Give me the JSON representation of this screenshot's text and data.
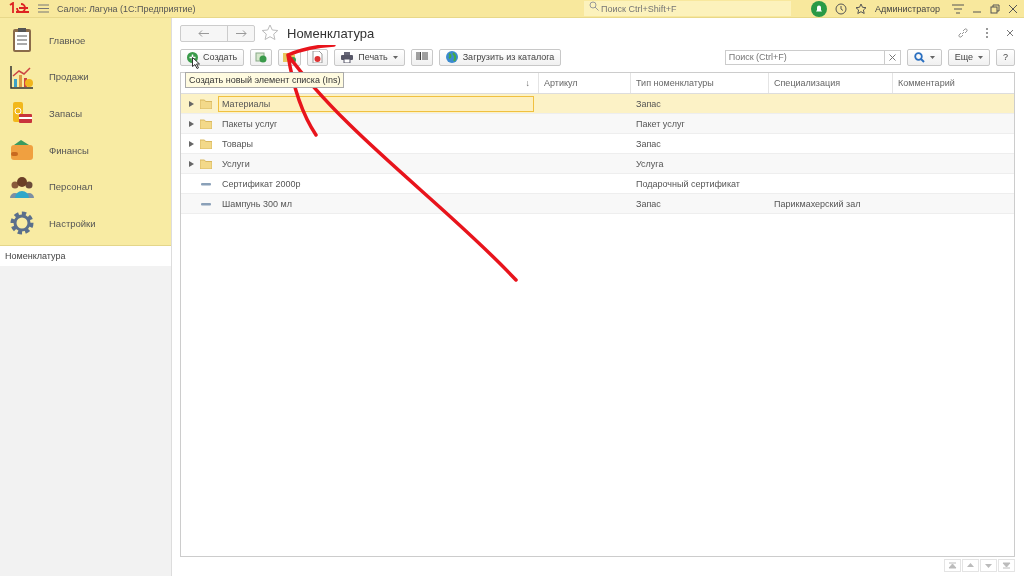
{
  "topbar": {
    "app_title": "Салон: Лагуна  (1С:Предприятие)",
    "search_placeholder": "Поиск Ctrl+Shift+F",
    "user": "Администратор"
  },
  "sidebar": {
    "sections": [
      {
        "label": "Главное",
        "selected": false
      },
      {
        "label": "Продажи",
        "selected": false
      },
      {
        "label": "Запасы",
        "selected": false
      },
      {
        "label": "Финансы",
        "selected": false
      },
      {
        "label": "Персонал",
        "selected": false
      },
      {
        "label": "Настройки",
        "selected": false
      }
    ],
    "open_windows": [
      {
        "label": "Номенклатура",
        "selected": true
      }
    ]
  },
  "form": {
    "title": "Номенклатура",
    "toolbar": {
      "create": "Создать",
      "print": "Печать",
      "load": "Загрузить из каталога",
      "search_placeholder": "Поиск (Ctrl+F)",
      "more": "Еще",
      "help": "?"
    },
    "tooltip": "Создать новый элемент списка (Ins)",
    "columns": [
      {
        "label": "↓"
      },
      {
        "label": "Артикул"
      },
      {
        "label": "Тип номенклатуры"
      },
      {
        "label": "Специализация"
      },
      {
        "label": "Комментарий"
      }
    ],
    "rows": [
      {
        "kind": "folder",
        "selected": true,
        "name": "Материалы",
        "type": "Запас"
      },
      {
        "kind": "folder",
        "selected": false,
        "name": "Пакеты услуг",
        "type": "Пакет услуг"
      },
      {
        "kind": "folder",
        "selected": false,
        "name": "Товары",
        "type": "Запас"
      },
      {
        "kind": "folder",
        "selected": false,
        "name": "Услуги",
        "type": "Услуга"
      },
      {
        "kind": "item",
        "selected": false,
        "name": "Сертификат 2000р",
        "type": "Подарочный сертификат"
      },
      {
        "kind": "item",
        "selected": false,
        "name": "Шампунь 300 мл",
        "type": "Запас",
        "specialization": "Парикмахерский зал"
      }
    ]
  }
}
